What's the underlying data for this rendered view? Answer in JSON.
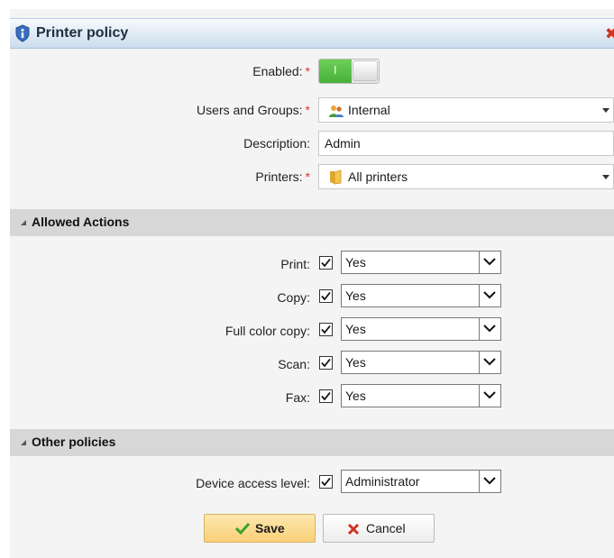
{
  "window": {
    "title": "Printer policy",
    "close_glyph": "✖",
    "title_icon": "shield-info-icon",
    "close_icon": "close-icon"
  },
  "form": {
    "enabled": {
      "label": "Enabled:",
      "required": "*",
      "toggle_text": "I",
      "value": "on"
    },
    "users_groups": {
      "label": "Users and Groups:",
      "required": "*",
      "value": "Internal",
      "icon": "group-icon"
    },
    "description": {
      "label": "Description:",
      "value": "Admin"
    },
    "printers": {
      "label": "Printers:",
      "required": "*",
      "value": "All printers",
      "icon": "folder-icon"
    }
  },
  "allowed_actions": {
    "title": "Allowed Actions",
    "rows": [
      {
        "label": "Print:",
        "checked": true,
        "value": "Yes"
      },
      {
        "label": "Copy:",
        "checked": true,
        "value": "Yes"
      },
      {
        "label": "Full color copy:",
        "checked": true,
        "value": "Yes"
      },
      {
        "label": "Scan:",
        "checked": true,
        "value": "Yes"
      },
      {
        "label": "Fax:",
        "checked": true,
        "value": "Yes"
      }
    ]
  },
  "other_policies": {
    "title": "Other policies",
    "device_access": {
      "label": "Device access level:",
      "checked": true,
      "value": "Administrator"
    }
  },
  "buttons": {
    "save": "Save",
    "cancel": "Cancel"
  },
  "colors": {
    "required": "#dd3333",
    "toggle_on": "#48b13a",
    "save_bg": "#fbd98a",
    "section_bg": "#d7d7d7"
  }
}
